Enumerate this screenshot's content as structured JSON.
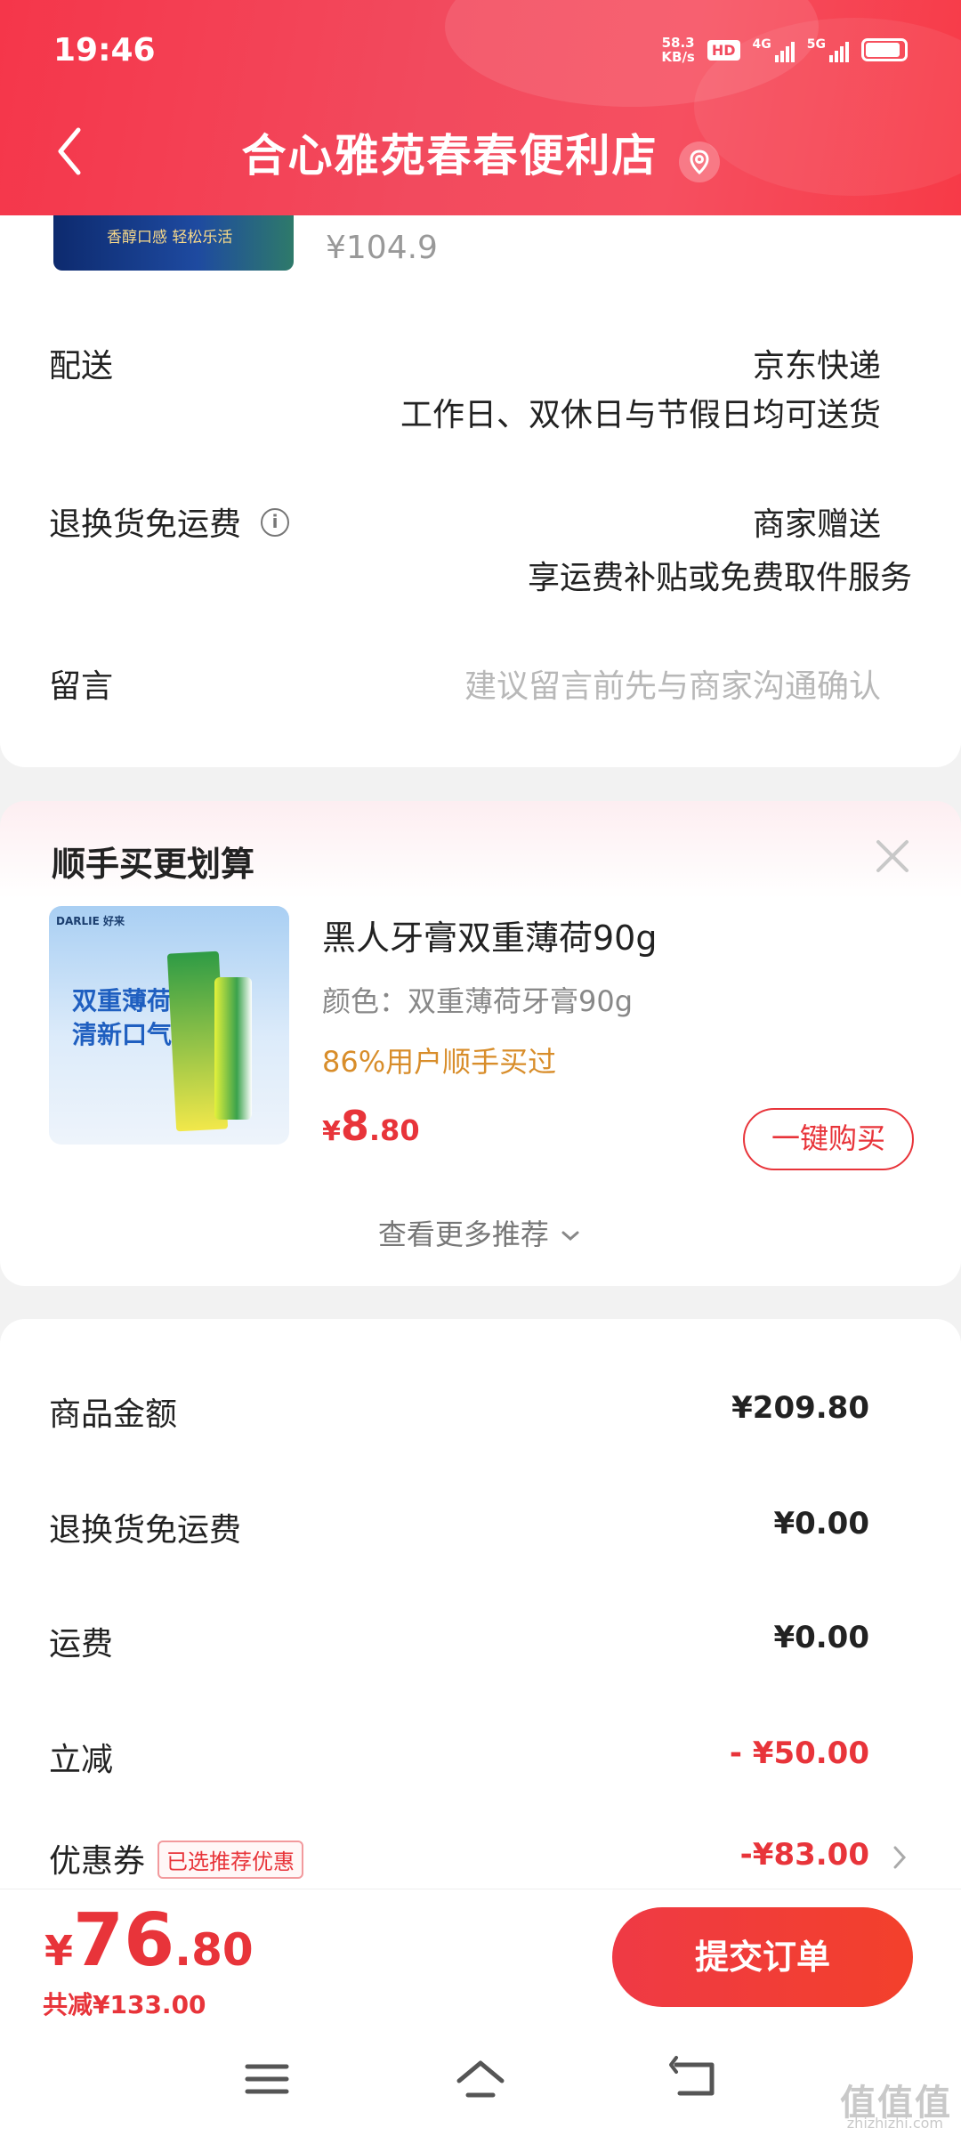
{
  "status_bar": {
    "time": "19:46",
    "net_speed_top": "58.3",
    "net_speed_unit": "KB/s",
    "hd": "HD",
    "sig1_label": "4G",
    "sig2_label": "5G"
  },
  "header": {
    "title": "合心雅苑春春便利店",
    "accent_color": "#f24a5e"
  },
  "order_item": {
    "thumb_text": "香醇口感 轻松乐活",
    "price": "¥104.9"
  },
  "delivery": {
    "label": "配送",
    "carrier": "京东快递",
    "schedule": "工作日、双休日与节假日均可送货"
  },
  "return_shipping": {
    "label": "退换货免运费",
    "value": "商家赠送",
    "detail": "享运费补贴或免费取件服务"
  },
  "message": {
    "label": "留言",
    "placeholder": "建议留言前先与商家沟通确认"
  },
  "recommend": {
    "title": "顺手买更划算",
    "image_text_line1": "双重薄荷",
    "image_text_line2": "清新口气",
    "image_brand": "DARLIE 好来",
    "product_name": "黑人牙膏双重薄荷90g",
    "spec": "颜色：双重薄荷牙膏90g",
    "social_proof": "86%用户顺手买过",
    "price_currency": "¥",
    "price_int": "8",
    "price_dec": ".80",
    "buy_label": "一键购买",
    "more_label": "查看更多推荐"
  },
  "summary": {
    "items": [
      {
        "label": "商品金额",
        "value": "¥209.80"
      },
      {
        "label": "退换货免运费",
        "value": "¥0.00"
      },
      {
        "label": "运费",
        "value": "¥0.00"
      },
      {
        "label": "立减",
        "value": "- ¥50.00"
      },
      {
        "label": "优惠券",
        "value": "-¥83.00",
        "tag": "已选推荐优惠"
      }
    ]
  },
  "checkout": {
    "currency": "¥",
    "total_int": "76",
    "total_dec": ".80",
    "saved": "共减¥133.00",
    "submit_label": "提交订单"
  },
  "watermark": {
    "main": "值值值",
    "sub": "zhizhizhi.com"
  }
}
